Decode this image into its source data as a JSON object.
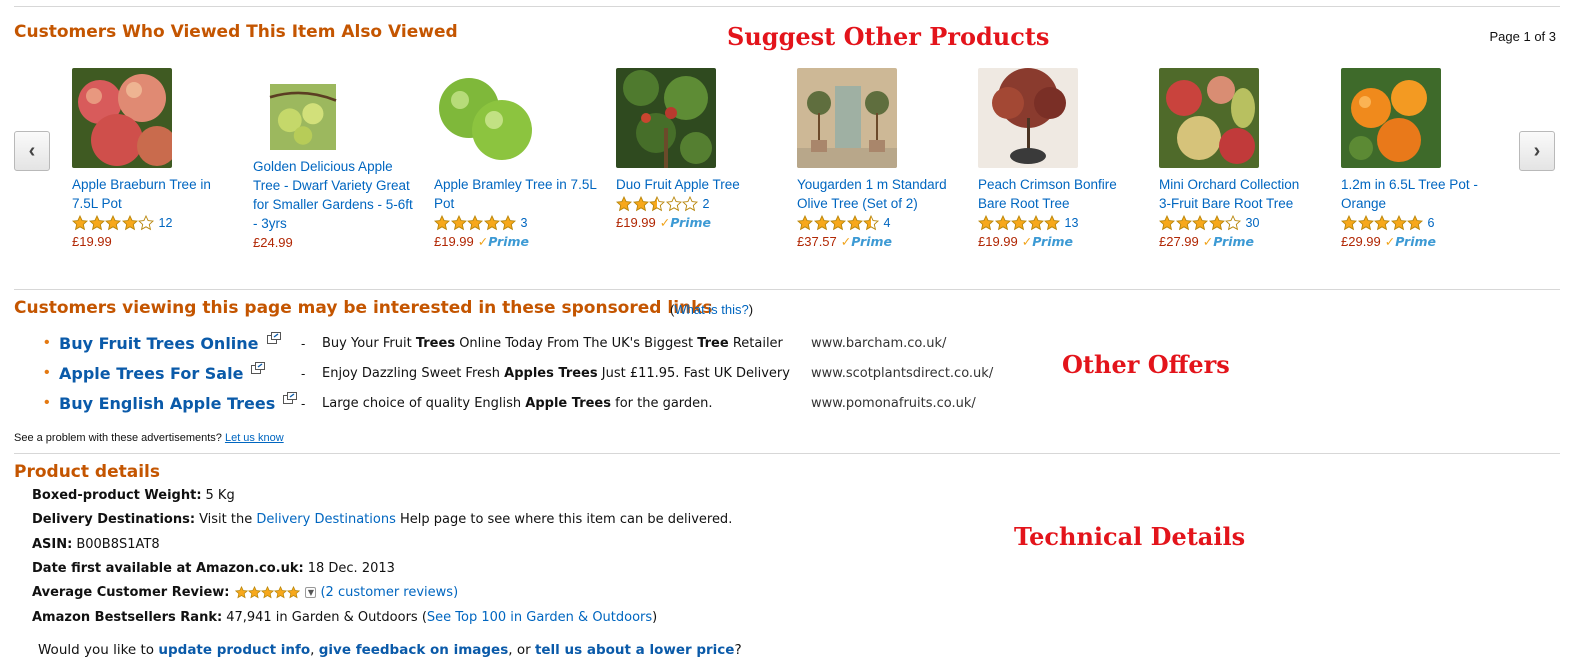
{
  "also_viewed": {
    "title": "Customers Who Viewed This Item Also Viewed",
    "page_indicator": "Page 1 of 3",
    "prev_icon": "chevron-left-icon",
    "next_icon": "chevron-right-icon",
    "products": [
      {
        "title_lines": [
          "Apple Braeburn Tree in",
          "7.5L Pot"
        ],
        "rating": 4,
        "reviews": "12",
        "price": "£19.99",
        "prime": false,
        "image": "red-green-apples"
      },
      {
        "title_lines": [
          "Golden Delicious Apple",
          "Tree - Dwarf Variety Great",
          "for Smaller Gardens - 5-6ft",
          "- 3yrs"
        ],
        "rating": null,
        "reviews": "",
        "price": "£24.99",
        "prime": false,
        "image": "green-apples-on-branch"
      },
      {
        "title_lines": [
          "Apple Bramley Tree in 7.5L",
          "Pot"
        ],
        "rating": 5,
        "reviews": "3",
        "price": "£19.99",
        "prime": true,
        "image": "green-apples"
      },
      {
        "title_lines": [
          "Duo Fruit Apple Tree"
        ],
        "rating": 2.5,
        "reviews": "2",
        "price": "£19.99",
        "prime": true,
        "image": "fruit-tree-foliage"
      },
      {
        "title_lines": [
          "Yougarden 1 m Standard",
          "Olive Tree (Set of 2)"
        ],
        "rating": 4.5,
        "reviews": "4",
        "price": "£37.57",
        "prime": true,
        "image": "olive-trees-by-door"
      },
      {
        "title_lines": [
          "Peach Crimson Bonfire",
          "Bare Root Tree"
        ],
        "rating": 5,
        "reviews": "13",
        "price": "£19.99",
        "prime": true,
        "image": "crimson-peach-tree"
      },
      {
        "title_lines": [
          "Mini Orchard Collection",
          "3-Fruit Bare Root Tree"
        ],
        "rating": 4,
        "reviews": "30",
        "price": "£27.99",
        "prime": true,
        "image": "mixed-fruits"
      },
      {
        "title_lines": [
          "1.2m in 6.5L Tree Pot -",
          "Orange"
        ],
        "rating": 5,
        "reviews": "6",
        "price": "£29.99",
        "prime": true,
        "image": "oranges-on-tree"
      }
    ],
    "prime_label": "Prime",
    "prime_check": "✓"
  },
  "annotations": {
    "suggest": "Suggest Other Products",
    "offers": "Other Offers",
    "technical": "Technical Details"
  },
  "sponsored": {
    "title": "Customers viewing this page may be interested in these sponsored links",
    "what_prefix": "(",
    "what_link": "What is this?",
    "what_suffix": ")",
    "separator": "-",
    "links": [
      {
        "label": "Buy Fruit Trees Online",
        "desc_parts": [
          "Buy Your Fruit ",
          "Trees",
          " Online Today From The UK's Biggest ",
          "Tree",
          " Retailer"
        ],
        "url": "www.barcham.co.uk/"
      },
      {
        "label": "Apple Trees For Sale",
        "desc_parts": [
          "Enjoy Dazzling Sweet Fresh ",
          "Apples Trees",
          " Just £11.95. Fast UK Delivery"
        ],
        "url": "www.scotplantsdirect.co.uk/"
      },
      {
        "label": "Buy English Apple Trees",
        "desc_parts": [
          "Large choice of quality English ",
          "Apple Trees",
          " for the garden."
        ],
        "url": "www.pomonafruits.co.uk/"
      }
    ],
    "problem_text": "See a problem with these advertisements? ",
    "problem_link": "Let us know"
  },
  "product_details": {
    "title": "Product details",
    "weight_label": "Boxed-product Weight:",
    "weight_value": "5 Kg",
    "delivery_label": "Delivery Destinations:",
    "delivery_pre": "Visit the ",
    "delivery_link": "Delivery Destinations",
    "delivery_post": " Help page to see where this item can be delivered.",
    "asin_label": "ASIN:",
    "asin_value": "B00B8S1AT8",
    "date_label": "Date first available at Amazon.co.uk:",
    "date_value": "18 Dec. 2013",
    "review_label": "Average Customer Review:",
    "review_rating": 5,
    "review_link": "(2 customer reviews)",
    "rank_label": "Amazon Bestsellers Rank:",
    "rank_value": "47,941 in Garden & Outdoors (",
    "rank_link": "See Top 100 in Garden & Outdoors",
    "rank_suffix": ")",
    "feedback_pre": "Would you like to ",
    "feedback_link1": "update product info",
    "feedback_sep1": ", ",
    "feedback_link2": "give feedback on images",
    "feedback_sep2": ", or ",
    "feedback_link3": "tell us about a lower price",
    "feedback_post": "?"
  },
  "colors": {
    "section_title": "#c45500",
    "link": "#0066c0",
    "price": "#b12704",
    "annotation": "#e3141b",
    "star": "#f7a81b"
  }
}
